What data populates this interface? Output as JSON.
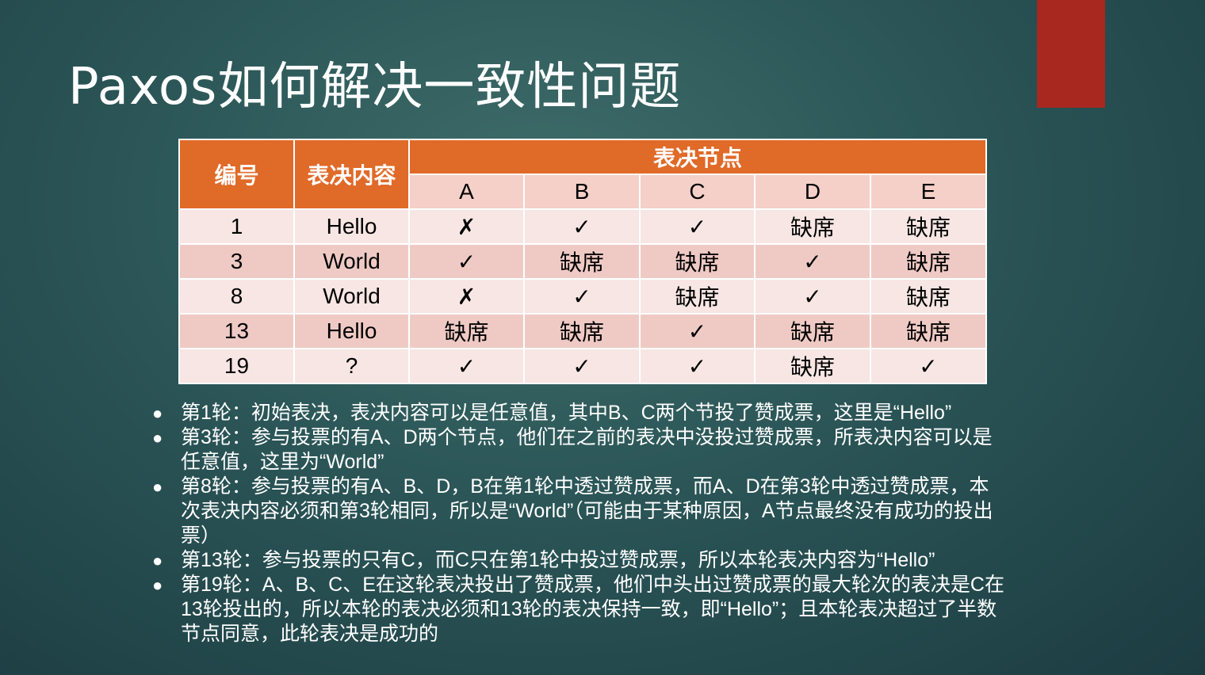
{
  "title": "Paxos如何解决一致性问题",
  "colors": {
    "accent_bar": "#a8281f",
    "header": "#e06a28",
    "row_light": "#f7e6e3",
    "row_dark": "#efcac4"
  },
  "table": {
    "col_id": "编号",
    "col_content": "表决内容",
    "col_nodes": "表决节点",
    "nodes": [
      "A",
      "B",
      "C",
      "D",
      "E"
    ],
    "rows": [
      {
        "id": "1",
        "content": "Hello",
        "votes": [
          "✗",
          "✓",
          "✓",
          "缺席",
          "缺席"
        ]
      },
      {
        "id": "3",
        "content": "World",
        "votes": [
          "✓",
          "缺席",
          "缺席",
          "✓",
          "缺席"
        ]
      },
      {
        "id": "8",
        "content": "World",
        "votes": [
          "✗",
          "✓",
          "缺席",
          "✓",
          "缺席"
        ]
      },
      {
        "id": "13",
        "content": "Hello",
        "votes": [
          "缺席",
          "缺席",
          "✓",
          "缺席",
          "缺席"
        ]
      },
      {
        "id": "19",
        "content": "?",
        "votes": [
          "✓",
          "✓",
          "✓",
          "缺席",
          "✓"
        ]
      }
    ]
  },
  "bullet_marker": "●",
  "bullets": [
    "第1轮：初始表决，表决内容可以是任意值，其中B、C两个节投了赞成票，这里是“Hello”",
    "第3轮：参与投票的有A、D两个节点，他们在之前的表决中没投过赞成票，所表决内容可以是任意值，这里为“World”",
    "第8轮：参与投票的有A、B、D，B在第1轮中透过赞成票，而A、D在第3轮中透过赞成票，本次表决内容必须和第3轮相同，所以是“World”（可能由于某种原因，A节点最终没有成功的投出票）",
    "第13轮：参与投票的只有C，而C只在第1轮中投过赞成票，所以本轮表决内容为“Hello”",
    "第19轮：A、B、C、E在这轮表决投出了赞成票，他们中头出过赞成票的最大轮次的表决是C在13轮投出的，所以本轮的表决必须和13轮的表决保持一致，即“Hello”；且本轮表决超过了半数节点同意，此轮表决是成功的"
  ]
}
